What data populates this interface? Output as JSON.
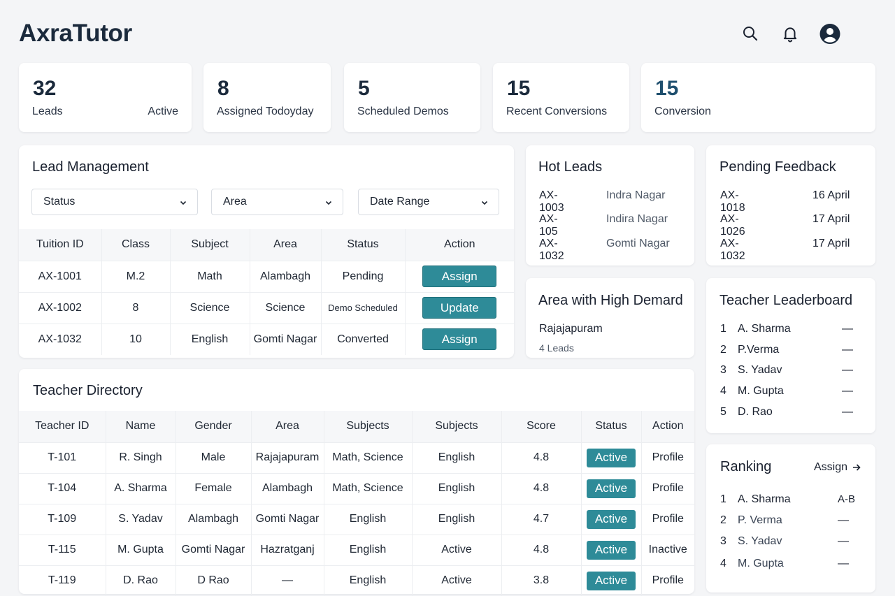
{
  "app": {
    "title": "AxraTutor"
  },
  "header_icons": [
    "search-icon",
    "bell-icon",
    "user-avatar-icon"
  ],
  "stats": [
    {
      "value": "32",
      "label": "Leads",
      "extra": "Active"
    },
    {
      "value": "8",
      "label": "Assigned Todoyday"
    },
    {
      "value": "5",
      "label": "Scheduled Demos"
    },
    {
      "value": "15",
      "label": "Recent Conversions"
    },
    {
      "value": "15",
      "label": "Conversion"
    }
  ],
  "lead_management": {
    "title": "Lead Management",
    "filters": [
      "Status",
      "Area",
      "Date Range"
    ],
    "columns": [
      "Tuition ID",
      "Class",
      "Subject",
      "Area",
      "Status",
      "Action"
    ],
    "rows": [
      {
        "id": "AX-1001",
        "class": "M.2",
        "subject": "Math",
        "area": "Alambagh",
        "status": "Pending",
        "action": "Assign"
      },
      {
        "id": "AX-1002",
        "class": "8",
        "subject": "Science",
        "area": "Science",
        "status": "Demo Scheduled",
        "action": "Update"
      },
      {
        "id": "AX-1032",
        "class": "10",
        "subject": "English",
        "area": "Gomti Nagar",
        "status": "Converted",
        "action": "Assign"
      }
    ]
  },
  "hot_leads": {
    "title": "Hot Leads",
    "items": [
      {
        "id": "AX-1003",
        "area": "Indra Nagar"
      },
      {
        "id": "AX-105",
        "area": "Indira Nagar"
      },
      {
        "id": "AX-1032",
        "area": "Gomti Nagar"
      }
    ]
  },
  "pending_feedback": {
    "title": "Pending Feedback",
    "items": [
      {
        "id": "AX-1018",
        "date": "16 April"
      },
      {
        "id": "AX-1026",
        "date": "17 April"
      },
      {
        "id": "AX-1032",
        "date": "17 April"
      }
    ]
  },
  "high_demand": {
    "title": "Area with High Demard",
    "area": "Rajajapuram",
    "leads": "4 Leads"
  },
  "leaderboard": {
    "title": "Teacher Leaderboard",
    "items": [
      {
        "rank": "1",
        "name": "A. Sharma",
        "value": "—"
      },
      {
        "rank": "2",
        "name": "P.Verma",
        "value": "—"
      },
      {
        "rank": "3",
        "name": "S. Yadav",
        "value": "—"
      },
      {
        "rank": "4",
        "name": "M. Gupta",
        "value": "—"
      },
      {
        "rank": "5",
        "name": "D. Rao",
        "value": "—"
      }
    ]
  },
  "ranking": {
    "title": "Ranking",
    "link": "Assign",
    "items": [
      {
        "rank": "1",
        "name": "A. Sharma",
        "value": "A-B"
      },
      {
        "rank": "2",
        "name": "P. Verma",
        "value": "—"
      },
      {
        "rank": "3",
        "name": "S. Yadav",
        "value": "—"
      },
      {
        "rank": "4",
        "name": "M. Gupta",
        "value": "—"
      }
    ]
  },
  "teacher_directory": {
    "title": "Teacher Directory",
    "columns": [
      "Teacher ID",
      "Name",
      "Gender",
      "Area",
      "Subjects",
      "Subjects",
      "Score",
      "Status",
      "Action"
    ],
    "rows": [
      {
        "id": "T-101",
        "name": "R. Singh",
        "gender": "Male",
        "area": "Rajajapuram",
        "subjects": "Math, Science",
        "subjects2": "English",
        "score": "4.8",
        "status": "Active",
        "action": "Profile"
      },
      {
        "id": "T-104",
        "name": "A. Sharma",
        "gender": "Female",
        "area": "Alambagh",
        "subjects": "Math, Science",
        "subjects2": "English",
        "score": "4.8",
        "status": "Active",
        "action": "Profile"
      },
      {
        "id": "T-109",
        "name": "S. Yadav",
        "gender": "Alambagh",
        "area": "Gomti Nagar",
        "subjects": "English",
        "subjects2": "English",
        "score": "4.7",
        "status": "Active",
        "action": "Profile"
      },
      {
        "id": "T-115",
        "name": "M. Gupta",
        "gender": "Gomti Nagar",
        "area": "Hazratganj",
        "subjects": "English",
        "subjects2": "Active",
        "score": "4.8",
        "status": "Active",
        "action": "Inactive"
      },
      {
        "id": "T-119",
        "name": "D. Rao",
        "gender": "D Rao",
        "area": "—",
        "subjects": "English",
        "subjects2": "Active",
        "score": "3.8",
        "status": "Active",
        "action": "Profile"
      }
    ]
  },
  "colors": {
    "accent": "#2e8b98",
    "title": "#1b2a3c",
    "background": "#f4f5f7"
  }
}
